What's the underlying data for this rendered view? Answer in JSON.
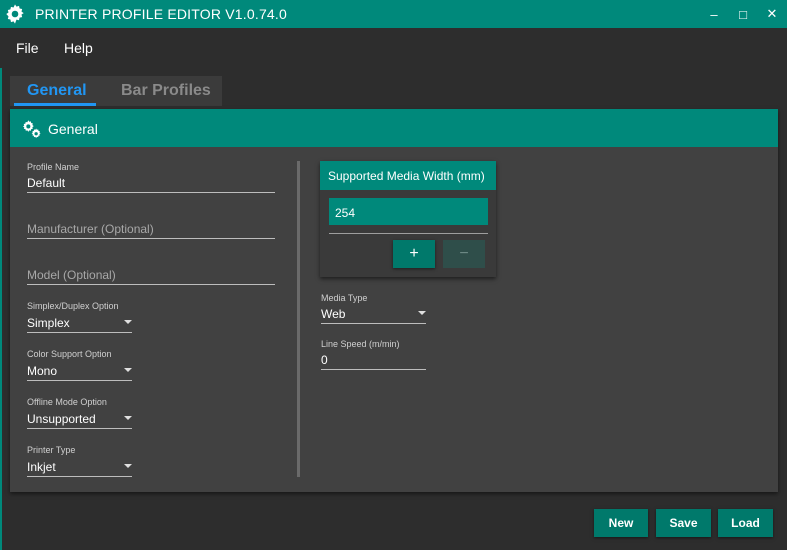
{
  "window": {
    "title": "PRINTER PROFILE EDITOR V1.0.74.0",
    "minimize_glyph": "‒",
    "maximize_glyph": "□",
    "close_glyph": "✕",
    "accent_color": "#00897b"
  },
  "menu": {
    "items": [
      {
        "label": "File"
      },
      {
        "label": "Help"
      }
    ]
  },
  "tabs": [
    {
      "label": "General",
      "selected": true
    },
    {
      "label": "Bar Profiles",
      "selected": false
    }
  ],
  "general_card": {
    "title": "General",
    "icon": "gears-icon",
    "profile_name": {
      "label": "Profile Name",
      "value": "Default"
    },
    "manufacturer": {
      "placeholder": "Manufacturer (Optional)",
      "value": ""
    },
    "model": {
      "placeholder": "Model (Optional)",
      "value": ""
    },
    "simplex_duplex": {
      "label": "Simplex/Duplex Option",
      "value": "Simplex"
    },
    "color_support": {
      "label": "Color Support Option",
      "value": "Mono"
    },
    "offline_mode": {
      "label": "Offline Mode Option",
      "value": "Unsupported"
    },
    "printer_type": {
      "label": "Printer Type",
      "value": "Inkjet"
    },
    "supported_media_width": {
      "title": "Supported Media Width (mm)",
      "items": [
        "254"
      ],
      "add_label": "+",
      "remove_label": "−"
    },
    "media_type": {
      "label": "Media Type",
      "value": "Web"
    },
    "line_speed": {
      "label": "Line Speed (m/min)",
      "value": "0"
    }
  },
  "footer": {
    "new_label": "New",
    "save_label": "Save",
    "load_label": "Load"
  }
}
